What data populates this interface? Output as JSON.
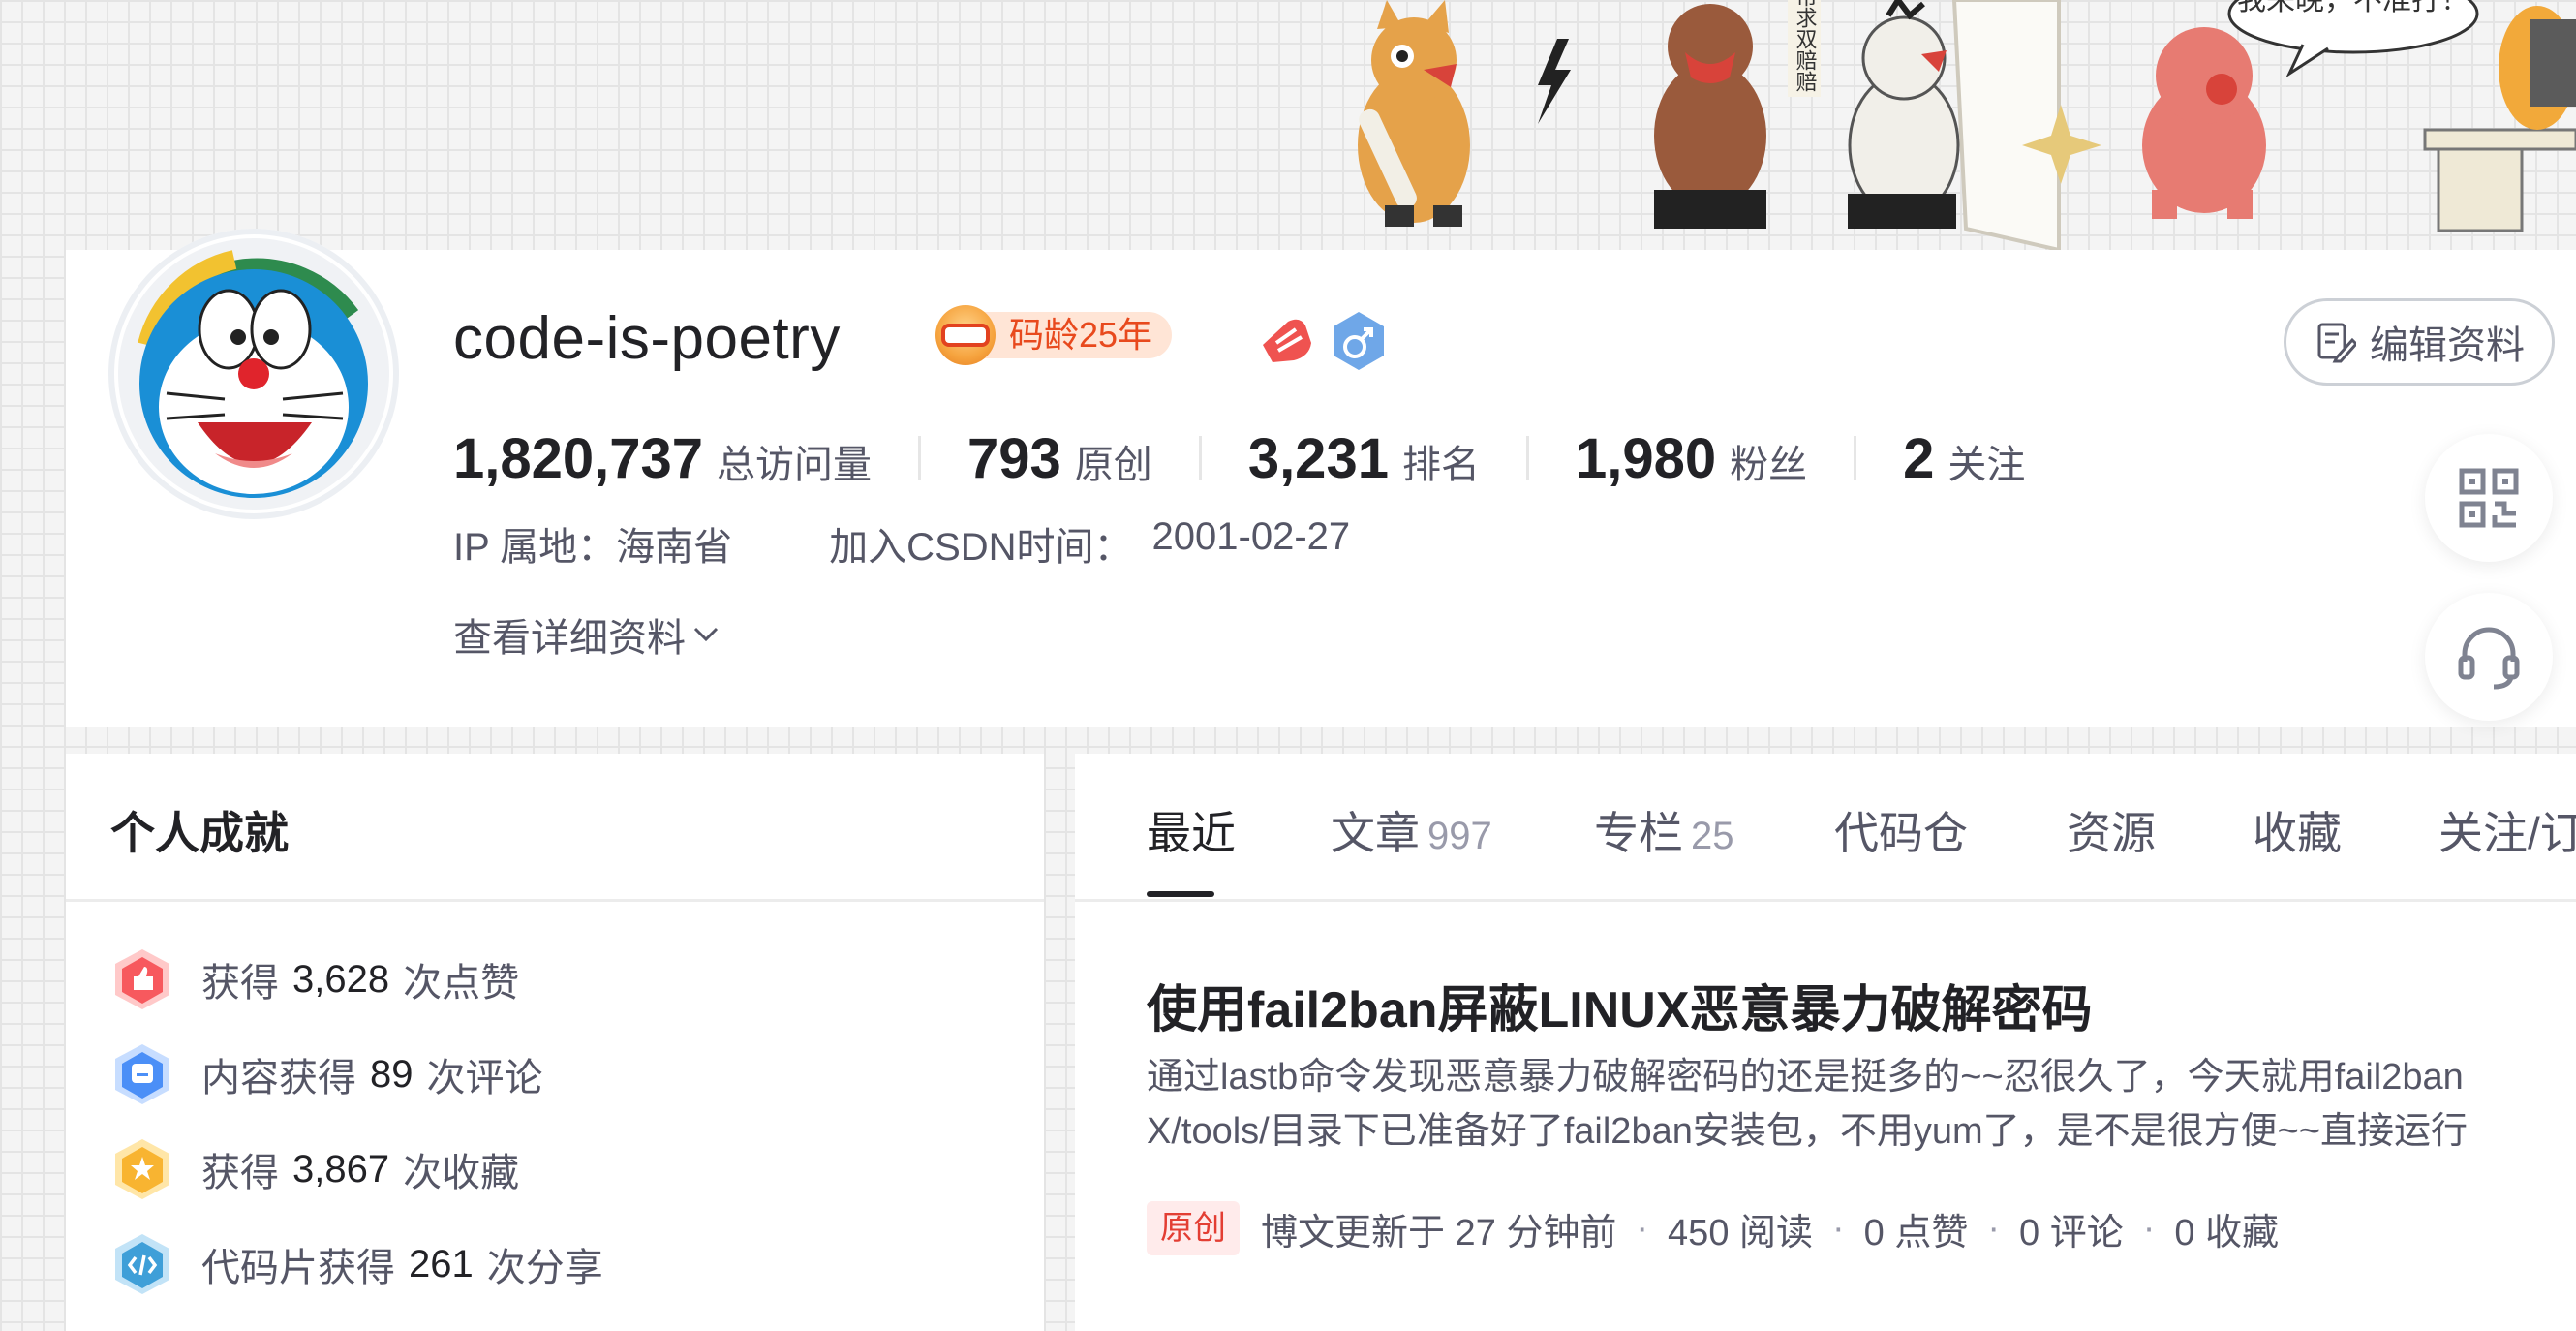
{
  "profile": {
    "username": "code-is-poetry",
    "code_age_badge": "码龄25年",
    "edit_button": "编辑资料",
    "stats": [
      {
        "value": "1,820,737",
        "label": "总访问量"
      },
      {
        "value": "793",
        "label": "原创"
      },
      {
        "value": "3,231",
        "label": "排名"
      },
      {
        "value": "1,980",
        "label": "粉丝"
      },
      {
        "value": "2",
        "label": "关注"
      }
    ],
    "ip_location": "IP 属地：海南省",
    "join_label": "加入CSDN时间：",
    "join_date": "2001-02-27",
    "more_info": "查看详细资料"
  },
  "banner": {
    "speech_text": "我来晚，不准打！",
    "sign_text": "帮求双赔赔"
  },
  "achievements": {
    "title": "个人成就",
    "items": [
      {
        "prefix": "获得",
        "value": "3,628",
        "suffix": "次点赞",
        "icon": "thumbs-up-icon"
      },
      {
        "prefix": "内容获得",
        "value": "89",
        "suffix": "次评论",
        "icon": "comment-icon"
      },
      {
        "prefix": "获得",
        "value": "3,867",
        "suffix": "次收藏",
        "icon": "star-icon"
      },
      {
        "prefix": "代码片获得",
        "value": "261",
        "suffix": "次分享",
        "icon": "code-share-icon"
      }
    ]
  },
  "tabs": [
    {
      "label": "最近",
      "count": ""
    },
    {
      "label": "文章",
      "count": "997"
    },
    {
      "label": "专栏",
      "count": "25"
    },
    {
      "label": "代码仓",
      "count": ""
    },
    {
      "label": "资源",
      "count": ""
    },
    {
      "label": "收藏",
      "count": ""
    },
    {
      "label": "关注/订阅",
      "count": ""
    }
  ],
  "article": {
    "title": "使用fail2ban屏蔽LINUX恶意暴力破解密码",
    "desc_line1": "通过lastb命令发现恶意暴力破解密码的还是挺多的~~忍很久了，今天就用fail2ban",
    "desc_line2": "X/tools/目录下已准备好了fail2ban安装包，不用yum了，是不是很方便~~直接运行",
    "tag": "原创",
    "updated": "博文更新于 27 分钟前",
    "reads": "450 阅读",
    "likes": "0 点赞",
    "comments": "0 评论",
    "favorites": "0 收藏"
  },
  "colors": {
    "accent_red": "#e33e33",
    "text_primary": "#222226",
    "text_secondary": "#555666",
    "badge_bg": "#ffe5d6"
  }
}
